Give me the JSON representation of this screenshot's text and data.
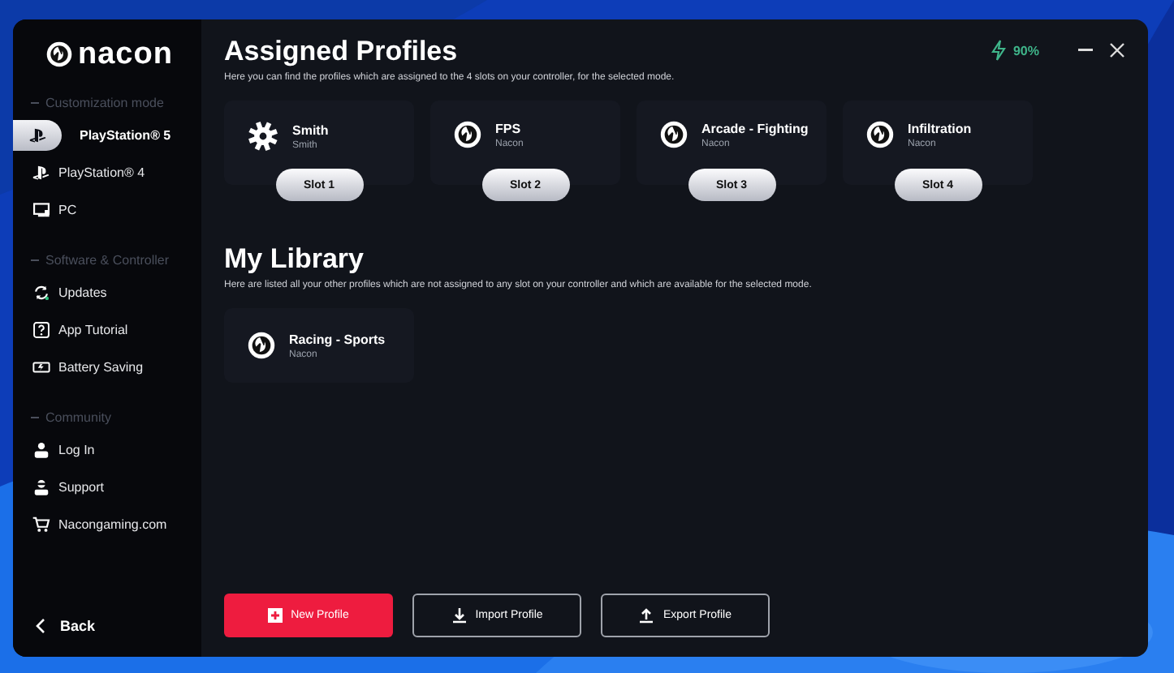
{
  "logo": "nacon",
  "sidebar": {
    "sections": [
      {
        "heading": "Customization mode",
        "items": [
          {
            "label": "PlayStation® 5",
            "selected": true
          },
          {
            "label": "PlayStation® 4",
            "selected": false
          },
          {
            "label": "PC",
            "selected": false
          }
        ]
      },
      {
        "heading": "Software & Controller",
        "items": [
          {
            "label": "Updates",
            "selected": false
          },
          {
            "label": "App Tutorial",
            "selected": false
          },
          {
            "label": "Battery Saving",
            "selected": false
          }
        ]
      },
      {
        "heading": "Community",
        "items": [
          {
            "label": "Log In",
            "selected": false
          },
          {
            "label": "Support",
            "selected": false
          },
          {
            "label": "Nacongaming.com",
            "selected": false
          }
        ]
      }
    ],
    "back": "Back"
  },
  "battery": "90%",
  "assigned": {
    "title": "Assigned Profiles",
    "description": "Here you can find the profiles which are assigned to the 4 slots on your controller, for the selected mode.",
    "profiles": [
      {
        "kind": "custom",
        "name": "Smith",
        "author": "Smith",
        "slot": "Slot 1"
      },
      {
        "kind": "nacon",
        "name": "FPS",
        "author": "Nacon",
        "slot": "Slot 2"
      },
      {
        "kind": "nacon",
        "name": "Arcade - Fighting",
        "author": "Nacon",
        "slot": "Slot 3"
      },
      {
        "kind": "nacon",
        "name": "Infiltration",
        "author": "Nacon",
        "slot": "Slot 4"
      }
    ]
  },
  "library": {
    "title": "My Library",
    "description": "Here are listed all your other profiles which are not assigned to any slot on your controller and which are available for the selected mode.",
    "profiles": [
      {
        "kind": "nacon",
        "name": "Racing - Sports",
        "author": "Nacon"
      }
    ]
  },
  "buttons": [
    {
      "kind": "primary",
      "label": "New Profile"
    },
    {
      "kind": "outline",
      "label": "Import Profile"
    },
    {
      "kind": "outline",
      "label": "Export Profile"
    }
  ]
}
